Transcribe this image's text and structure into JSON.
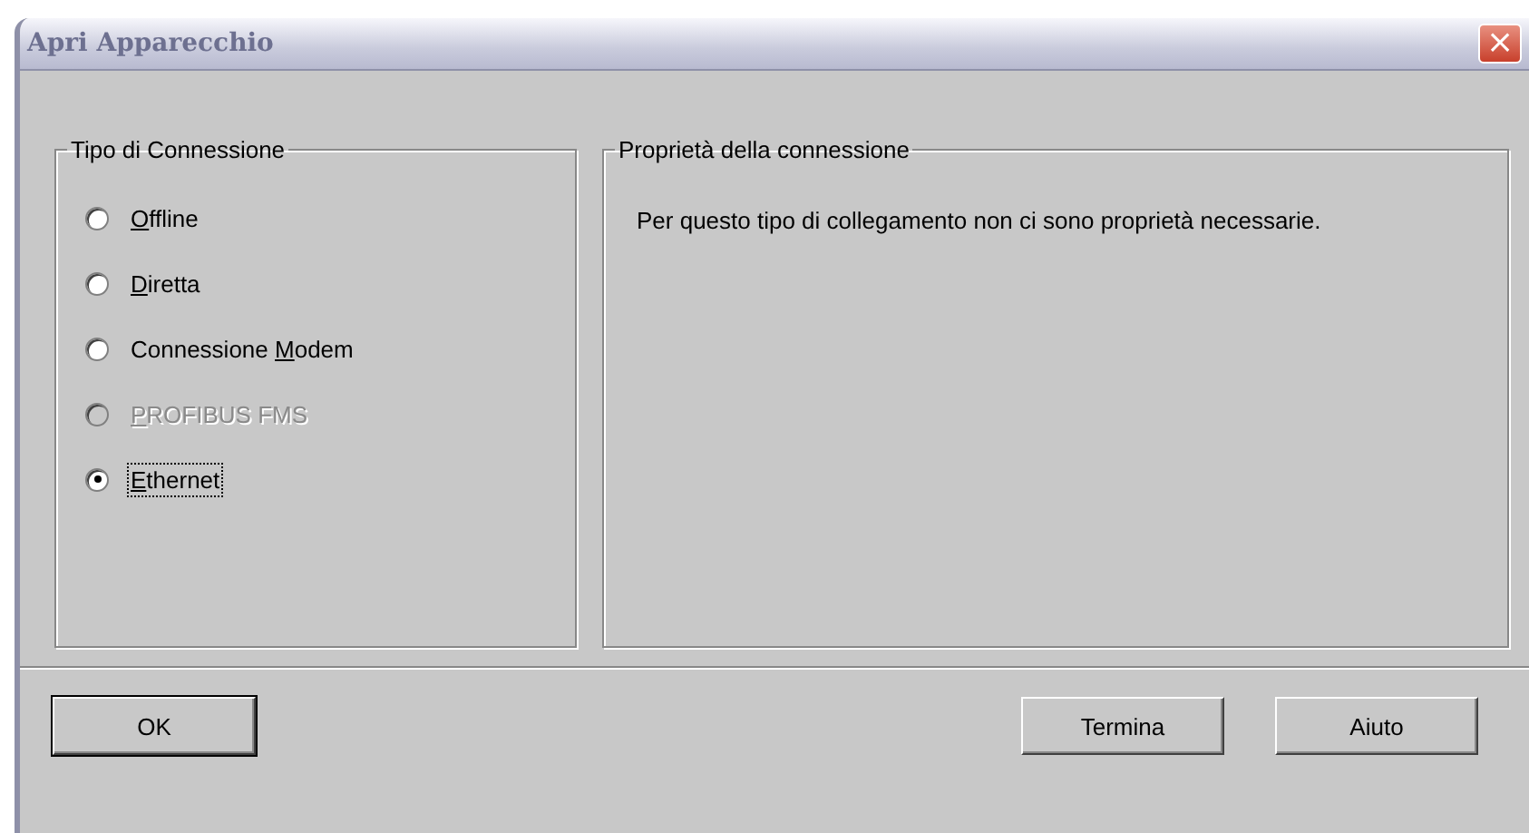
{
  "window": {
    "title": "Apri Apparecchio",
    "close": "×"
  },
  "connection_type": {
    "title": "Tipo di Connessione",
    "options": [
      {
        "label": {
          "key": "O",
          "after": "ffline"
        },
        "selected": false,
        "disabled": false,
        "focused": false
      },
      {
        "label": {
          "key": "D",
          "after": "iretta"
        },
        "selected": false,
        "disabled": false,
        "focused": false
      },
      {
        "label": {
          "before": "Connessione ",
          "key": "M",
          "after": "odem"
        },
        "selected": false,
        "disabled": false,
        "focused": false
      },
      {
        "label": {
          "key": "P",
          "after": "ROFIBUS FMS"
        },
        "selected": false,
        "disabled": true,
        "focused": false
      },
      {
        "label": {
          "key": "E",
          "after": "thernet"
        },
        "selected": true,
        "disabled": false,
        "focused": true
      }
    ]
  },
  "properties": {
    "title": "Proprietà della connessione",
    "message": "Per questo tipo di collegamento non ci sono proprietà necessarie."
  },
  "buttons": [
    {
      "label": "OK",
      "default": true
    },
    {
      "label": "Termina",
      "default": false
    },
    {
      "label": "Aiuto",
      "default": false
    }
  ]
}
